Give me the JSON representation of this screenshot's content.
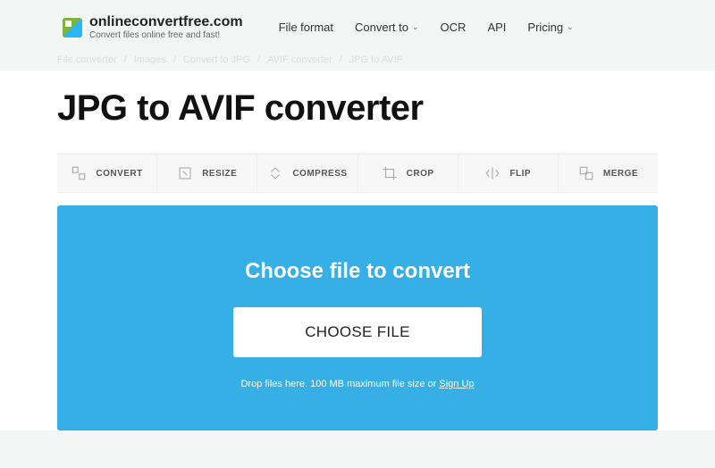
{
  "header": {
    "domain": "onlineconvertfree.com",
    "tagline": "Convert files online free and fast!",
    "nav": [
      {
        "label": "File format",
        "dropdown": false
      },
      {
        "label": "Convert to",
        "dropdown": true
      },
      {
        "label": "OCR",
        "dropdown": false
      },
      {
        "label": "API",
        "dropdown": false
      },
      {
        "label": "Pricing",
        "dropdown": true
      }
    ]
  },
  "breadcrumb": {
    "items": [
      "File converter",
      "Images",
      "Convert to JPG",
      "AVIF converter",
      "JPG to AVIF"
    ]
  },
  "page": {
    "title": "JPG to AVIF converter"
  },
  "tools": {
    "tabs": [
      {
        "id": "convert",
        "label": "CONVERT"
      },
      {
        "id": "resize",
        "label": "RESIZE"
      },
      {
        "id": "compress",
        "label": "COMPRESS"
      },
      {
        "id": "crop",
        "label": "CROP"
      },
      {
        "id": "flip",
        "label": "FLIP"
      },
      {
        "id": "merge",
        "label": "MERGE"
      }
    ]
  },
  "dropzone": {
    "title": "Choose file to convert",
    "button": "CHOOSE FILE",
    "hint_prefix": "Drop files here. 100 MB maximum file size or ",
    "hint_link": "Sign Up"
  },
  "colors": {
    "accent": "#36aee6"
  }
}
